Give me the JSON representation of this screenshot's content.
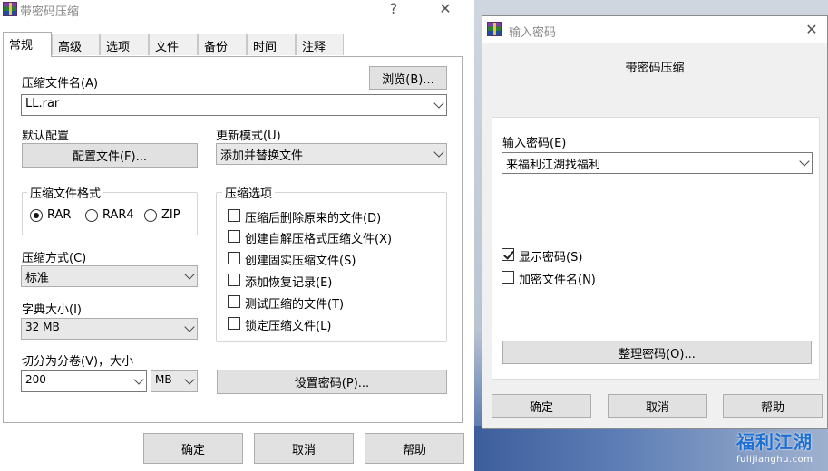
{
  "main_dialog": {
    "title": "带密码压缩",
    "help_glyph": "?",
    "close_glyph": "✕",
    "tabs": [
      "常规",
      "高级",
      "选项",
      "文件",
      "备份",
      "时间",
      "注释"
    ],
    "archive_name_label": "压缩文件名(A)",
    "browse_button": "浏览(B)...",
    "archive_name_value": "LL.rar",
    "default_profile_label": "默认配置",
    "profiles_button": "配置文件(F)...",
    "update_mode_label": "更新模式(U)",
    "update_mode_value": "添加并替换文件",
    "format_group_title": "压缩文件格式",
    "formats": [
      {
        "label": "RAR",
        "checked": true
      },
      {
        "label": "RAR4",
        "checked": false
      },
      {
        "label": "ZIP",
        "checked": false
      }
    ],
    "options_group_title": "压缩选项",
    "options": [
      {
        "label": "压缩后删除原来的文件(D)",
        "checked": false
      },
      {
        "label": "创建自解压格式压缩文件(X)",
        "checked": false
      },
      {
        "label": "创建固实压缩文件(S)",
        "checked": false
      },
      {
        "label": "添加恢复记录(E)",
        "checked": false
      },
      {
        "label": "测试压缩的文件(T)",
        "checked": false
      },
      {
        "label": "锁定压缩文件(L)",
        "checked": false
      }
    ],
    "method_label": "压缩方式(C)",
    "method_value": "标准",
    "dict_label": "字典大小(I)",
    "dict_value": "32 MB",
    "split_label": "切分为分卷(V)，大小",
    "split_value": "200",
    "split_unit": "MB",
    "set_password_button": "设置密码(P)...",
    "ok_button": "确定",
    "cancel_button": "取消",
    "help_button": "帮助"
  },
  "password_dialog": {
    "title": "输入密码",
    "close_glyph": "✕",
    "subtitle": "带密码压缩",
    "password_label": "输入密码(E)",
    "password_value": "来福利江湖找福利",
    "show_password_label": "显示密码(S)",
    "show_password_checked": true,
    "encrypt_names_label": "加密文件名(N)",
    "encrypt_names_checked": false,
    "organize_button": "整理密码(O)...",
    "ok_button": "确定",
    "cancel_button": "取消",
    "help_button": "帮助"
  },
  "watermark": {
    "main": "福利江湖",
    "sub": "fulijianghu.com"
  },
  "colors": {
    "dialog_bg": "#f0f0f0",
    "button_bg": "#e1e1e1",
    "watermark_blue": "#1e6fd0"
  }
}
